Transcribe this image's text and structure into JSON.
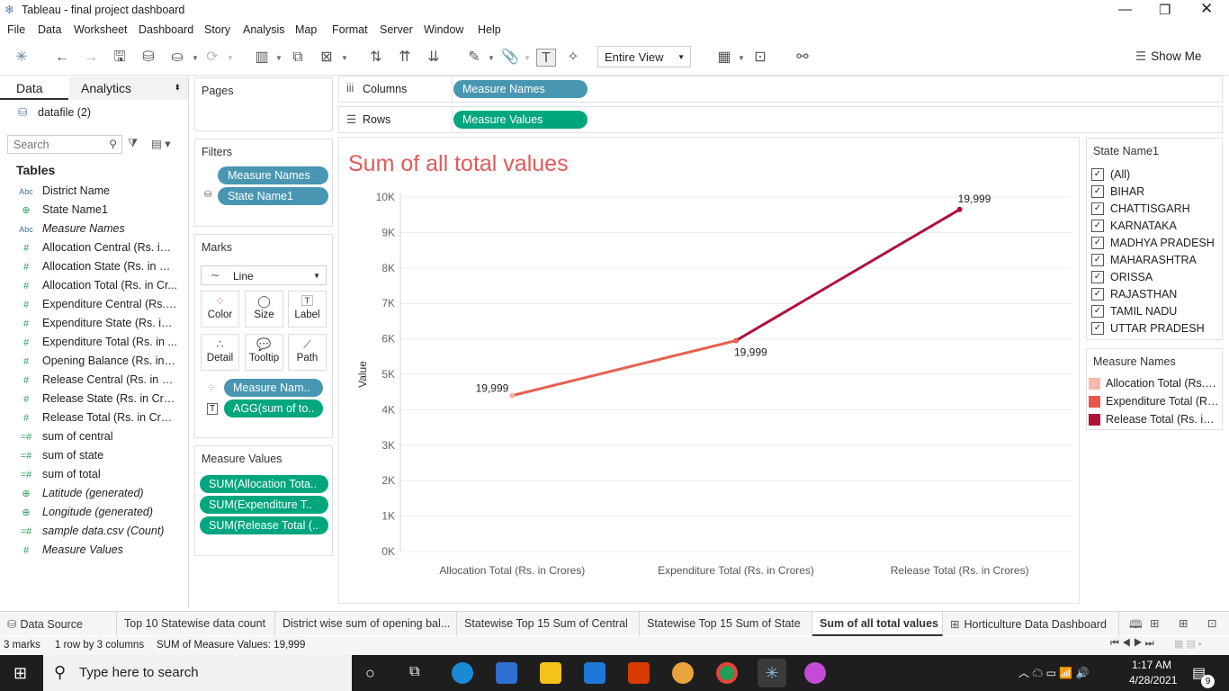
{
  "window": {
    "title": "Tableau - final project dashboard"
  },
  "menu": [
    "File",
    "Data",
    "Worksheet",
    "Dashboard",
    "Story",
    "Analysis",
    "Map",
    "Format",
    "Server",
    "Window",
    "Help"
  ],
  "toolbar": {
    "fit": "Entire View",
    "show_me": "Show Me"
  },
  "left": {
    "tab_data": "Data",
    "tab_analytics": "Analytics",
    "datasource": "datafile (2)",
    "search_placeholder": "Search",
    "tables_header": "Tables",
    "fields": [
      {
        "icon": "Abc",
        "name": "District Name",
        "italic": false
      },
      {
        "icon": "globe",
        "name": "State Name1",
        "italic": false
      },
      {
        "icon": "Abc",
        "name": "Measure Names",
        "italic": true
      },
      {
        "icon": "#",
        "name": "Allocation Central (Rs. in ...",
        "italic": false
      },
      {
        "icon": "#",
        "name": "Allocation State (Rs. in Cr...",
        "italic": false
      },
      {
        "icon": "#",
        "name": "Allocation Total (Rs. in Cr...",
        "italic": false
      },
      {
        "icon": "#",
        "name": "Expenditure Central (Rs. i...",
        "italic": false
      },
      {
        "icon": "#",
        "name": "Expenditure State (Rs. in ...",
        "italic": false
      },
      {
        "icon": "#",
        "name": "Expenditure Total (Rs. in ...",
        "italic": false
      },
      {
        "icon": "#",
        "name": "Opening Balance (Rs. in C...",
        "italic": false
      },
      {
        "icon": "#",
        "name": "Release Central (Rs. in Cr...",
        "italic": false
      },
      {
        "icon": "#",
        "name": "Release State (Rs. in Cror...",
        "italic": false
      },
      {
        "icon": "#",
        "name": "Release Total (Rs. in Cror...",
        "italic": false
      },
      {
        "icon": "=#",
        "name": "sum of central",
        "italic": false
      },
      {
        "icon": "=#",
        "name": "sum of state",
        "italic": false
      },
      {
        "icon": "=#",
        "name": "sum of total",
        "italic": false
      },
      {
        "icon": "globe",
        "name": "Latitude (generated)",
        "italic": true
      },
      {
        "icon": "globe",
        "name": "Longitude (generated)",
        "italic": true
      },
      {
        "icon": "=#",
        "name": "sample data.csv (Count)",
        "italic": true
      },
      {
        "icon": "#",
        "name": "Measure Values",
        "italic": true
      }
    ]
  },
  "pages": {
    "label": "Pages"
  },
  "filters": {
    "label": "Filters",
    "pills": [
      "Measure Names",
      "State Name1"
    ]
  },
  "marks": {
    "label": "Marks",
    "type": "Line",
    "buttons": [
      "Color",
      "Size",
      "Label",
      "Detail",
      "Tooltip",
      "Path"
    ],
    "pills": [
      "Measure Nam..",
      "AGG(sum of to.."
    ]
  },
  "measure_values": {
    "label": "Measure Values",
    "pills": [
      "SUM(Allocation Tota..",
      "SUM(Expenditure T..",
      "SUM(Release Total (.."
    ]
  },
  "shelves": {
    "columns_label": "Columns",
    "columns_pill": "Measure Names",
    "rows_label": "Rows",
    "rows_pill": "Measure Values"
  },
  "chart_data": {
    "type": "line",
    "title": "Sum of all total values",
    "ylabel": "Value",
    "xlabel": "",
    "categories": [
      "Allocation Total (Rs. in Crores)",
      "Expenditure Total (Rs. in Crores)",
      "Release Total (Rs. in Crores)"
    ],
    "values": [
      4400,
      5950,
      9650
    ],
    "data_labels": [
      "19,999",
      "19,999",
      "19,999"
    ],
    "ylim": [
      0,
      10000
    ],
    "yticks": [
      "0K",
      "1K",
      "2K",
      "3K",
      "4K",
      "5K",
      "6K",
      "7K",
      "8K",
      "9K",
      "10K"
    ],
    "colors": [
      "#f4b0a0",
      "#e75f4f",
      "#b0123d"
    ],
    "grid": true
  },
  "state_filter": {
    "title": "State Name1",
    "items": [
      "(All)",
      "BIHAR",
      "CHATTISGARH",
      "KARNATAKA",
      "MADHYA PRADESH",
      "MAHARASHTRA",
      "ORISSA",
      "RAJASTHAN",
      "TAMIL NADU",
      "UTTAR PRADESH"
    ],
    "check": "✓"
  },
  "legend": {
    "title": "Measure Names",
    "items": [
      {
        "label": "Allocation Total (Rs. in Crores)",
        "color": "#f7b9ab"
      },
      {
        "label": "Expenditure Total (Rs. in Crores)",
        "color": "#e8564a"
      },
      {
        "label": "Release Total (Rs. in Crores)",
        "color": "#b0123d"
      }
    ]
  },
  "sheet_tabs": [
    "Data Source",
    "Top 10 Statewise data count",
    "District wise sum of opening bal...",
    "Statewise Top 15  Sum of Central",
    "Statewise Top 15  Sum of State",
    "Sum of all total values",
    "Horticulture Data Dashboard"
  ],
  "status": {
    "marks": "3 marks",
    "rows": "1 row by 3 columns",
    "sum": "SUM of Measure Values: 19,999"
  },
  "taskbar": {
    "search_placeholder": "Type here to search",
    "time": "1:17 AM",
    "date": "4/28/2021",
    "notif": "9"
  }
}
